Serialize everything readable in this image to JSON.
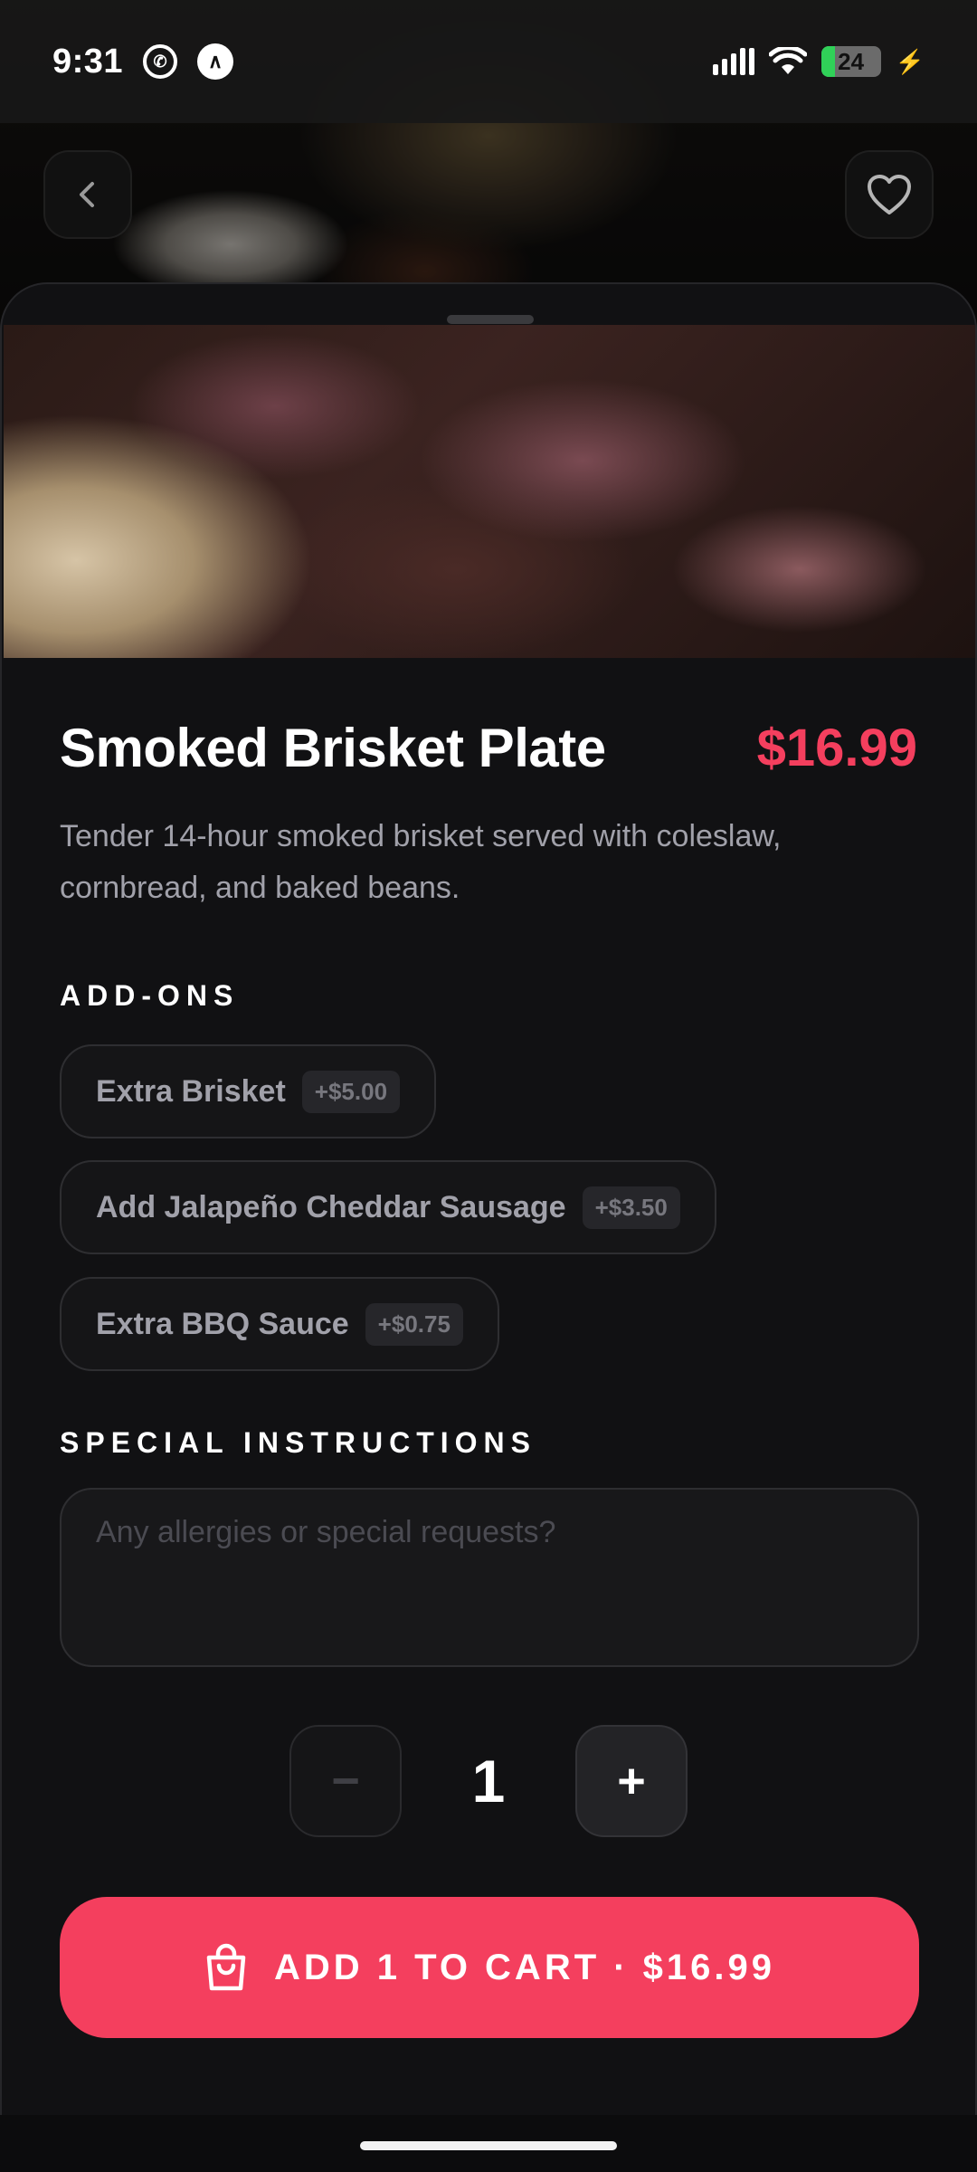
{
  "status_bar": {
    "time": "9:31",
    "battery_level": "24",
    "battery_fraction": 0.24,
    "icons": [
      "whatsapp-icon",
      "app-notification-icon",
      "signal-icon",
      "wifi-icon",
      "battery-icon",
      "charging-icon"
    ]
  },
  "nav": {
    "back_icon": "chevron-left-icon",
    "favorite_icon": "heart-icon"
  },
  "product": {
    "title": "Smoked Brisket Plate",
    "price": "$16.99",
    "description": "Tender 14-hour smoked brisket served with coleslaw, cornbread, and baked beans."
  },
  "addons": {
    "label": "ADD-ONS",
    "items": [
      {
        "name": "Extra Brisket",
        "price": "+$5.00"
      },
      {
        "name": "Add Jalapeño Cheddar Sausage",
        "price": "+$3.50"
      },
      {
        "name": "Extra BBQ Sauce",
        "price": "+$0.75"
      }
    ]
  },
  "instructions": {
    "label": "SPECIAL INSTRUCTIONS",
    "placeholder": "Any allergies or special requests?",
    "value": ""
  },
  "quantity": {
    "minus": "−",
    "value": "1",
    "plus": "+"
  },
  "cart": {
    "label": "ADD 1 TO CART · $16.99",
    "icon": "shopping-bag-icon"
  },
  "colors": {
    "accent": "#f43f5e",
    "background": "#111113",
    "muted_text": "#a1a1aa"
  }
}
